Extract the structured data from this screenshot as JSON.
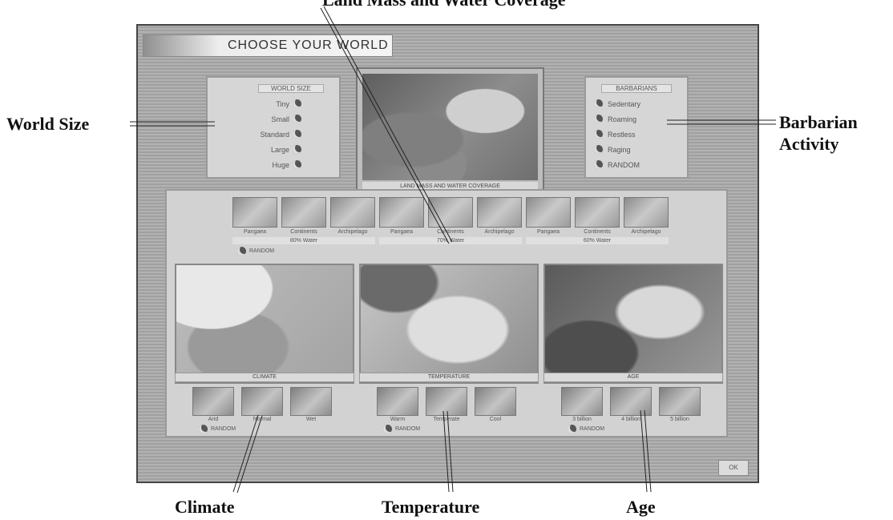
{
  "callouts": {
    "terrain": "Land Mass and Water Coverage",
    "world_size": "World Size",
    "barbarian_1": "Barbarian",
    "barbarian_2": "Activity",
    "climate": "Climate",
    "temperature": "Temperature",
    "age": "Age"
  },
  "screen_title": "CHOOSE YOUR WORLD",
  "world_size": {
    "title": "WORLD SIZE",
    "options": [
      "Tiny",
      "Small",
      "Standard",
      "Large",
      "Huge"
    ]
  },
  "map_label": "LAND MASS AND WATER COVERAGE",
  "barbarians": {
    "title": "BARBARIANS",
    "options": [
      "Sedentary",
      "Roaming",
      "Restless",
      "Raging",
      "RANDOM"
    ]
  },
  "landmass": {
    "groups": [
      {
        "label": "80% Water",
        "types": [
          "Pangaea",
          "Continents",
          "Archipelago"
        ]
      },
      {
        "label": "70% Water",
        "types": [
          "Pangaea",
          "Continents",
          "Archipelago"
        ]
      },
      {
        "label": "60% Water",
        "types": [
          "Pangaea",
          "Continents",
          "Archipelago"
        ]
      }
    ],
    "random": "RANDOM"
  },
  "climate": {
    "label": "CLIMATE",
    "options": [
      "Arid",
      "Normal",
      "Wet"
    ],
    "random": "RANDOM"
  },
  "temperature": {
    "label": "TEMPERATURE",
    "options": [
      "Warm",
      "Temperate",
      "Cool"
    ],
    "random": "RANDOM"
  },
  "age": {
    "label": "AGE",
    "options": [
      "3 billion",
      "4 billion",
      "5 billion"
    ],
    "random": "RANDOM"
  },
  "ok_label": "OK"
}
